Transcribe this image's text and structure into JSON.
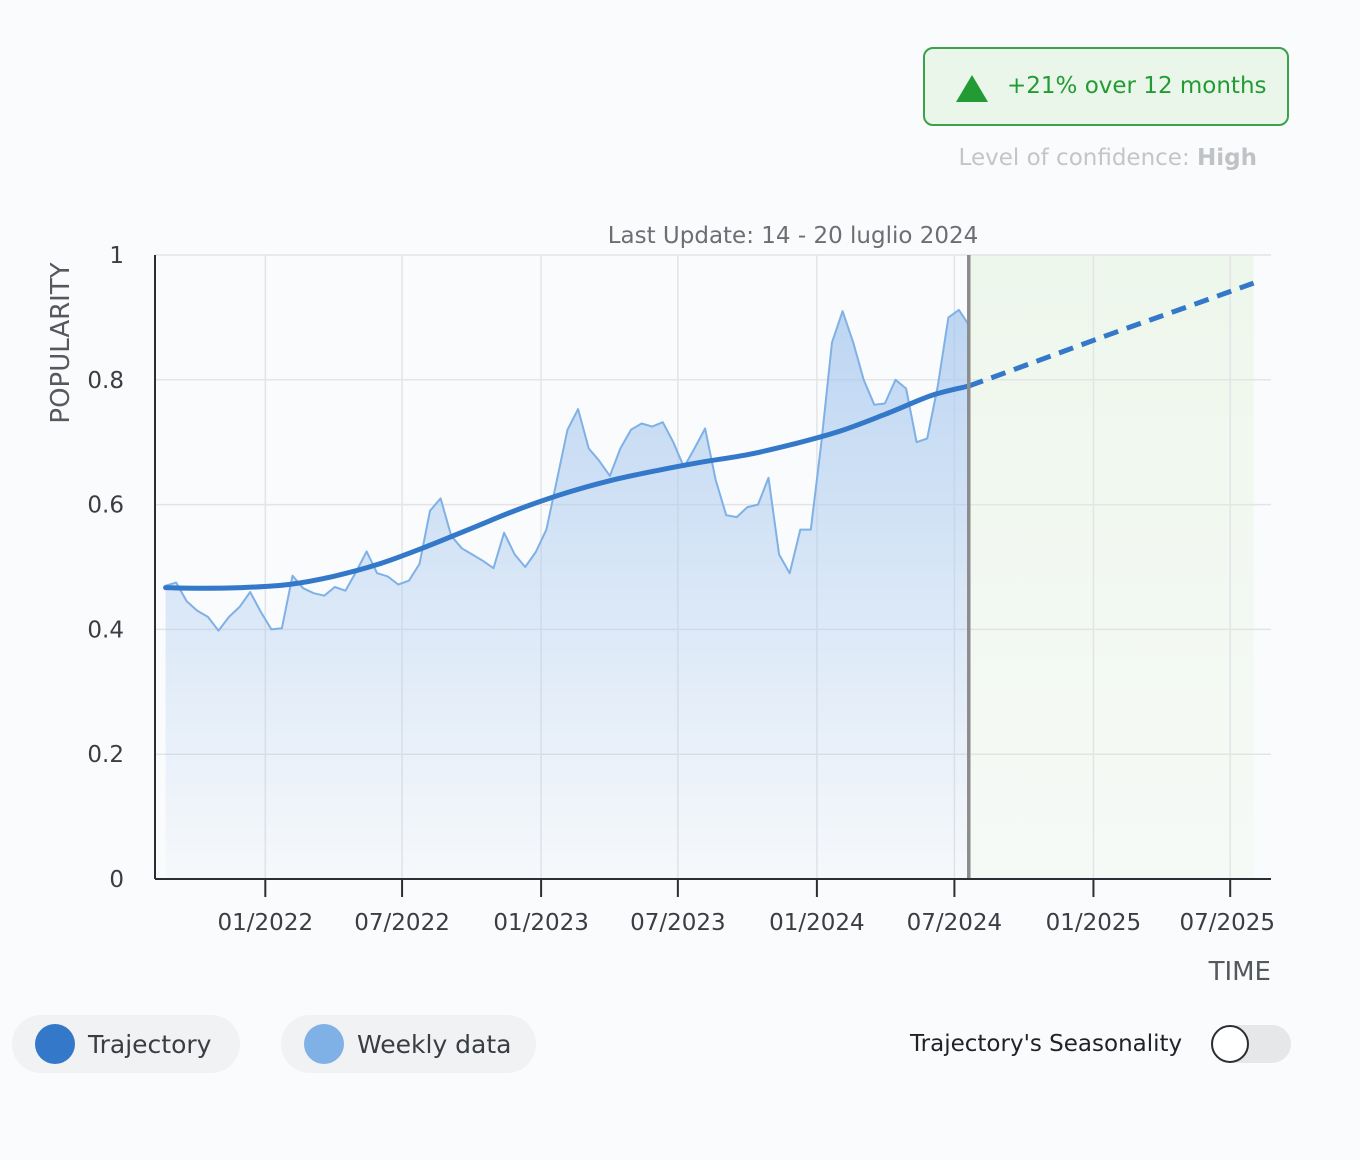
{
  "badge": {
    "text": "+21% over 12 months",
    "icon": "triangle-up-icon",
    "color": "#239b34",
    "background": "#eaf6ea"
  },
  "confidence": {
    "label": "Level of confidence: ",
    "value": "High"
  },
  "legend": {
    "trajectory_label": "Trajectory",
    "weekly_label": "Weekly data",
    "trajectory_color": "#3478c9",
    "weekly_color": "#7fb1e6"
  },
  "seasonality": {
    "label": "Trajectory's Seasonality",
    "enabled": false
  },
  "chart_data": {
    "type": "area",
    "annotation": "Last Update: 14 - 20 luglio 2024",
    "ylabel": "POPULARITY",
    "xlabel": "TIME",
    "ylim": [
      0,
      1
    ],
    "yticks": [
      0,
      0.2,
      0.4,
      0.6,
      0.8,
      1
    ],
    "ytick_labels": [
      "0",
      "0.2",
      "0.4",
      "0.6",
      "0.8",
      "1"
    ],
    "xlim": [
      "2021-08-08",
      "2025-08-24"
    ],
    "xticks": [
      "2022-01-01",
      "2022-07-01",
      "2023-01-01",
      "2023-07-01",
      "2024-01-01",
      "2024-07-01",
      "2025-01-01",
      "2025-07-01"
    ],
    "xtick_labels": [
      "01/2022",
      "07/2022",
      "01/2023",
      "07/2023",
      "01/2024",
      "07/2024",
      "01/2025",
      "07/2025"
    ],
    "last_update": "2024-07-20",
    "forecast_range": [
      "2024-07-20",
      "2025-08-01"
    ],
    "grid": true,
    "colors": {
      "trajectory": "#3478c9",
      "weekly": "#7fb1e6",
      "forecast_band": "#eef7ec",
      "update_line": "#8c8c8c"
    },
    "series": [
      {
        "name": "Weekly data",
        "kind": "area",
        "points": [
          [
            "2021-08-22",
            0.47
          ],
          [
            "2021-09-05",
            0.475
          ],
          [
            "2021-09-19",
            0.445
          ],
          [
            "2021-10-03",
            0.43
          ],
          [
            "2021-10-17",
            0.42
          ],
          [
            "2021-10-31",
            0.398
          ],
          [
            "2021-11-14",
            0.42
          ],
          [
            "2021-11-28",
            0.436
          ],
          [
            "2021-12-12",
            0.46
          ],
          [
            "2021-12-26",
            0.428
          ],
          [
            "2022-01-09",
            0.4
          ],
          [
            "2022-01-23",
            0.402
          ],
          [
            "2022-02-06",
            0.486
          ],
          [
            "2022-02-20",
            0.466
          ],
          [
            "2022-03-06",
            0.458
          ],
          [
            "2022-03-20",
            0.454
          ],
          [
            "2022-04-03",
            0.468
          ],
          [
            "2022-04-17",
            0.462
          ],
          [
            "2022-05-01",
            0.492
          ],
          [
            "2022-05-15",
            0.525
          ],
          [
            "2022-05-29",
            0.49
          ],
          [
            "2022-06-12",
            0.485
          ],
          [
            "2022-06-26",
            0.472
          ],
          [
            "2022-07-10",
            0.478
          ],
          [
            "2022-07-24",
            0.505
          ],
          [
            "2022-08-07",
            0.59
          ],
          [
            "2022-08-21",
            0.61
          ],
          [
            "2022-09-04",
            0.55
          ],
          [
            "2022-09-18",
            0.53
          ],
          [
            "2022-10-02",
            0.52
          ],
          [
            "2022-10-16",
            0.51
          ],
          [
            "2022-10-30",
            0.498
          ],
          [
            "2022-11-13",
            0.555
          ],
          [
            "2022-11-27",
            0.52
          ],
          [
            "2022-12-11",
            0.5
          ],
          [
            "2022-12-25",
            0.524
          ],
          [
            "2023-01-08",
            0.56
          ],
          [
            "2023-01-22",
            0.64
          ],
          [
            "2023-02-05",
            0.72
          ],
          [
            "2023-02-19",
            0.753
          ],
          [
            "2023-03-05",
            0.69
          ],
          [
            "2023-03-19",
            0.67
          ],
          [
            "2023-04-02",
            0.646
          ],
          [
            "2023-04-16",
            0.69
          ],
          [
            "2023-04-30",
            0.72
          ],
          [
            "2023-05-14",
            0.73
          ],
          [
            "2023-05-28",
            0.725
          ],
          [
            "2023-06-11",
            0.732
          ],
          [
            "2023-06-25",
            0.7
          ],
          [
            "2023-07-09",
            0.66
          ],
          [
            "2023-07-23",
            0.69
          ],
          [
            "2023-08-06",
            0.722
          ],
          [
            "2023-08-20",
            0.64
          ],
          [
            "2023-09-03",
            0.583
          ],
          [
            "2023-09-17",
            0.58
          ],
          [
            "2023-10-01",
            0.596
          ],
          [
            "2023-10-15",
            0.6
          ],
          [
            "2023-10-29",
            0.643
          ],
          [
            "2023-11-12",
            0.52
          ],
          [
            "2023-11-26",
            0.49
          ],
          [
            "2023-12-10",
            0.56
          ],
          [
            "2023-12-24",
            0.56
          ],
          [
            "2024-01-07",
            0.7
          ],
          [
            "2024-01-21",
            0.86
          ],
          [
            "2024-02-04",
            0.91
          ],
          [
            "2024-02-18",
            0.86
          ],
          [
            "2024-03-03",
            0.8
          ],
          [
            "2024-03-17",
            0.76
          ],
          [
            "2024-03-31",
            0.762
          ],
          [
            "2024-04-14",
            0.8
          ],
          [
            "2024-04-28",
            0.786
          ],
          [
            "2024-05-12",
            0.7
          ],
          [
            "2024-05-26",
            0.706
          ],
          [
            "2024-06-09",
            0.79
          ],
          [
            "2024-06-23",
            0.9
          ],
          [
            "2024-07-07",
            0.912
          ],
          [
            "2024-07-20",
            0.888
          ]
        ]
      },
      {
        "name": "Trajectory",
        "kind": "line",
        "points": [
          [
            "2021-08-22",
            0.467
          ],
          [
            "2021-10-01",
            0.466
          ],
          [
            "2021-12-01",
            0.467
          ],
          [
            "2022-02-01",
            0.472
          ],
          [
            "2022-04-01",
            0.485
          ],
          [
            "2022-06-01",
            0.505
          ],
          [
            "2022-08-01",
            0.532
          ],
          [
            "2022-10-01",
            0.562
          ],
          [
            "2022-12-01",
            0.592
          ],
          [
            "2023-02-01",
            0.618
          ],
          [
            "2023-04-01",
            0.638
          ],
          [
            "2023-06-01",
            0.654
          ],
          [
            "2023-08-01",
            0.668
          ],
          [
            "2023-10-01",
            0.68
          ],
          [
            "2023-12-01",
            0.697
          ],
          [
            "2024-02-01",
            0.718
          ],
          [
            "2024-04-01",
            0.745
          ],
          [
            "2024-06-01",
            0.775
          ],
          [
            "2024-07-20",
            0.79
          ]
        ]
      },
      {
        "name": "Trajectory",
        "kind": "forecast",
        "points": [
          [
            "2024-07-20",
            0.79
          ],
          [
            "2024-11-01",
            0.836
          ],
          [
            "2025-02-01",
            0.877
          ],
          [
            "2025-05-01",
            0.915
          ],
          [
            "2025-08-01",
            0.955
          ]
        ]
      }
    ]
  }
}
